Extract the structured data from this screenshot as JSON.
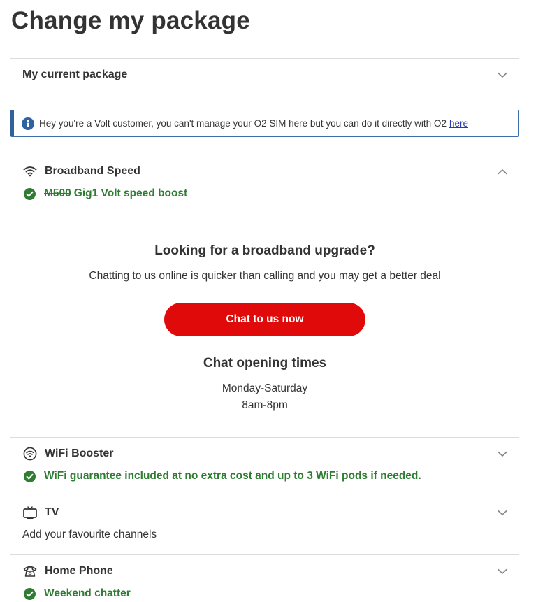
{
  "page": {
    "title": "Change my package"
  },
  "current_package": {
    "label": "My current package"
  },
  "alert": {
    "text": "Hey you're a Volt customer, you can't manage your O2 SIM here but you can do it directly with O2",
    "link_text": "here"
  },
  "broadband": {
    "title": "Broadband Speed",
    "old_plan": "M500",
    "new_plan": "Gig1 Volt speed boost"
  },
  "upgrade": {
    "title": "Looking for a broadband upgrade?",
    "text": "Chatting to us online is quicker than calling and you may get a better deal",
    "button_label": "Chat to us now",
    "times_title": "Chat opening times",
    "days": "Monday-Saturday",
    "hours": "8am-8pm"
  },
  "wifi": {
    "title": "WiFi Booster",
    "status": "WiFi guarantee included at no extra cost and up to 3 WiFi pods if needed."
  },
  "tv": {
    "title": "TV",
    "text": "Add your favourite channels"
  },
  "home_phone": {
    "title": "Home Phone",
    "status": "Weekend chatter"
  },
  "colors": {
    "accent_red": "#e10a0a",
    "success_green": "#2e7d32",
    "info_blue": "#2f63a0"
  },
  "icons": [
    "chevron-down-icon",
    "chevron-up-icon",
    "info-icon",
    "wifi-icon",
    "check-circle-icon",
    "wifi-booster-icon",
    "tv-icon",
    "home-phone-icon"
  ]
}
